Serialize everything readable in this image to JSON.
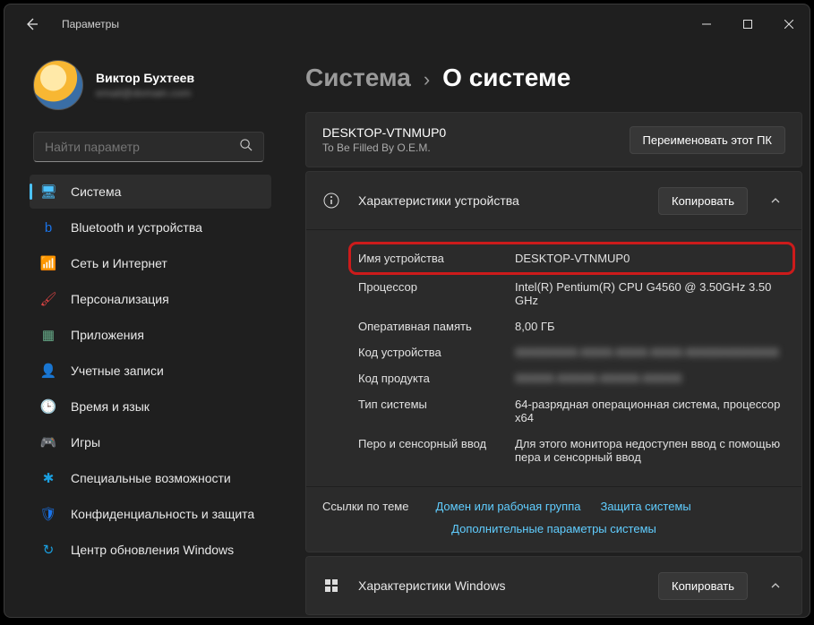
{
  "window": {
    "title": "Параметры"
  },
  "user": {
    "name": "Виктор Бухтеев",
    "email": "email@domain.com"
  },
  "search": {
    "placeholder": "Найти параметр"
  },
  "nav": [
    {
      "id": "system",
      "label": "Система",
      "icon": "🖥",
      "color": "#4cc2ff",
      "active": true
    },
    {
      "id": "bluetooth",
      "label": "Bluetooth и устройства",
      "icon": "b",
      "color": "#1a73e8"
    },
    {
      "id": "network",
      "label": "Сеть и Интернет",
      "icon": "📶",
      "color": "#00b7c3"
    },
    {
      "id": "personalization",
      "label": "Персонализация",
      "icon": "🖌",
      "color": "#d44"
    },
    {
      "id": "apps",
      "label": "Приложения",
      "icon": "▦",
      "color": "#6a8"
    },
    {
      "id": "accounts",
      "label": "Учетные записи",
      "icon": "👤",
      "color": "#888"
    },
    {
      "id": "time",
      "label": "Время и язык",
      "icon": "🕒",
      "color": "#1a73e8"
    },
    {
      "id": "gaming",
      "label": "Игры",
      "icon": "🎮",
      "color": "#888"
    },
    {
      "id": "accessibility",
      "label": "Специальные возможности",
      "icon": "✱",
      "color": "#1a9fe0"
    },
    {
      "id": "privacy",
      "label": "Конфиденциальность и защита",
      "icon": "🛡",
      "color": "#1a73e8"
    },
    {
      "id": "update",
      "label": "Центр обновления Windows",
      "icon": "↻",
      "color": "#1a9fe0"
    }
  ],
  "breadcrumb": {
    "parent": "Система",
    "current": "О системе"
  },
  "device": {
    "name": "DESKTOP-VTNMUP0",
    "oem": "To Be Filled By O.E.M.",
    "rename_btn": "Переименовать этот ПК"
  },
  "spec_section": {
    "title": "Характеристики устройства",
    "copy_btn": "Копировать",
    "rows": [
      {
        "k": "Имя устройства",
        "v": "DESKTOP-VTNMUP0",
        "hl": true
      },
      {
        "k": "Процессор",
        "v": "Intel(R) Pentium(R) CPU G4560 @ 3.50GHz   3.50 GHz"
      },
      {
        "k": "Оперативная память",
        "v": "8,00 ГБ"
      },
      {
        "k": "Код устройства",
        "v": "XXXXXXXX-XXXX-XXXX-XXXX-XXXXXXXXXXXX",
        "blur": true
      },
      {
        "k": "Код продукта",
        "v": "XXXXX-XXXXX-XXXXX-XXXXX",
        "blur": true
      },
      {
        "k": "Тип системы",
        "v": "64-разрядная операционная система, процессор x64"
      },
      {
        "k": "Перо и сенсорный ввод",
        "v": "Для этого монитора недоступен ввод с помощью пера и сенсорный ввод"
      }
    ]
  },
  "links": {
    "label": "Ссылки по теме",
    "items": [
      "Домен или рабочая группа",
      "Защита системы",
      "Дополнительные параметры системы"
    ]
  },
  "win_section": {
    "title": "Характеристики Windows",
    "copy_btn": "Копировать"
  }
}
